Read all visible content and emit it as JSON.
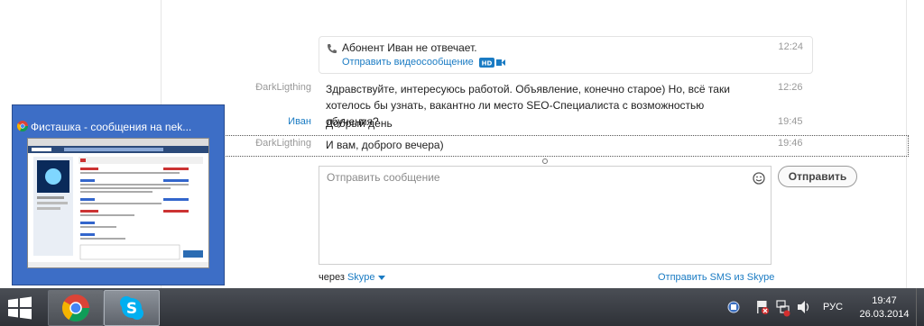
{
  "call": {
    "status": "Абонент Иван не отвечает.",
    "time": "12:24",
    "video_link": "Отправить видеосообщение",
    "hd_badge": "HD"
  },
  "messages": [
    {
      "sender": "ÐarkLigthing",
      "text": "Здравствуйте, интересуюсь работой. Объявление, конечно старое) Но, всё таки хотелось бы узнать, вакантно ли место SEO-Специалиста с возможностью обучения?",
      "time": "12:26"
    },
    {
      "sender": "Иван",
      "text": "Добрый день",
      "time": "19:45"
    },
    {
      "sender": "ÐarkLigthing",
      "text": "И вам, доброго вечера)",
      "time": "19:46"
    }
  ],
  "composer": {
    "placeholder": "Отправить сообщение",
    "send_label": "Отправить",
    "via_prefix": "через",
    "via_service": "Skype",
    "sms_link": "Отправить SMS из Skype"
  },
  "thumbnail": {
    "title": "Фисташка - сообщения на nek..."
  },
  "taskbar": {
    "language": "РУС",
    "time": "19:47",
    "date": "26.03.2014"
  },
  "colors": {
    "link": "#1a7bc3",
    "taskbar": "#2e3137",
    "thumb_bg": "#3d6ec6"
  }
}
